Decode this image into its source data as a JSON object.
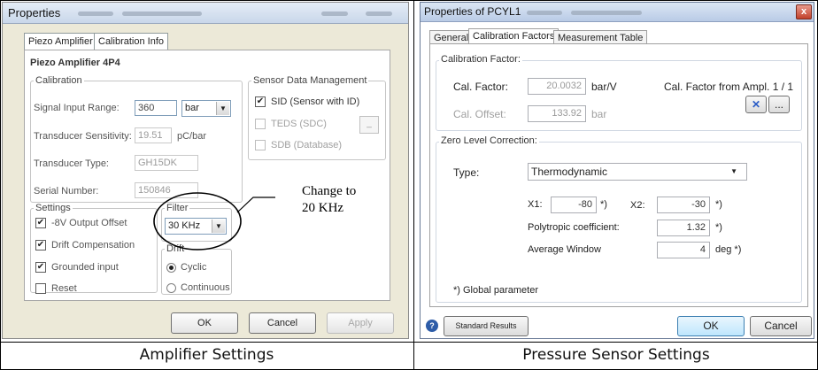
{
  "amplifier": {
    "window_title": "Properties",
    "tabs": [
      "Piezo Amplifier",
      "Calibration Info"
    ],
    "heading": "Piezo Amplifier 4P4",
    "calibration": {
      "group": "Calibration",
      "signal_input_range_label": "Signal Input Range:",
      "signal_input_range_value": "360",
      "signal_unit": "bar",
      "transducer_sensitivity_label": "Transducer Sensitivity:",
      "transducer_sensitivity_value": "19.51",
      "sensitivity_unit": "pC/bar",
      "transducer_type_label": "Transducer Type:",
      "transducer_type_value": "GH15DK",
      "serial_number_label": "Serial Number:",
      "serial_number_value": "150846"
    },
    "sensor_data": {
      "group": "Sensor Data Management",
      "sid": "SID (Sensor with ID)",
      "teds": "TEDS (SDC)",
      "sdb": "SDB (Database)"
    },
    "settings": {
      "group": "Settings",
      "output_offset": "-8V Output Offset",
      "drift_compensation": "Drift Compensation",
      "grounded_input": "Grounded input",
      "reset": "Reset"
    },
    "filter": {
      "group": "Filter",
      "value": "30 KHz"
    },
    "drift": {
      "group": "Drift",
      "cyclic": "Cyclic",
      "continuous": "Continuous"
    },
    "buttons": {
      "ok": "OK",
      "cancel": "Cancel",
      "apply": "Apply"
    },
    "annotation": "Change to\n20 KHz"
  },
  "sensor": {
    "window_title": "Properties of PCYL1",
    "close": "x",
    "tabs": [
      "General",
      "Calibration Factors",
      "Measurement Table"
    ],
    "calibration_factor": {
      "group": "Calibration Factor:",
      "cal_factor_label": "Cal. Factor:",
      "cal_factor_value": "20.0032",
      "cal_factor_unit": "bar/V",
      "cal_offset_label": "Cal. Offset:",
      "cal_offset_value": "133.92",
      "cal_offset_unit": "bar",
      "from_ampl_label": "Cal. Factor from Ampl. 1 / 1",
      "x_button": "✕",
      "more_button": "..."
    },
    "zero_level": {
      "group": "Zero Level Correction:",
      "type_label": "Type:",
      "type_value": "Thermodynamic",
      "x1_label": "X1:",
      "x1_value": "-80",
      "x1_suffix": "*)",
      "x2_label": "X2:",
      "x2_value": "-30",
      "x2_suffix": "*)",
      "polytropic_label": "Polytropic coefficient:",
      "polytropic_value": "1.32",
      "polytropic_suffix": "*)",
      "avg_window_label": "Average Window",
      "avg_window_value": "4",
      "avg_window_suffix": "deg *)",
      "global_param": "*) Global parameter"
    },
    "buttons": {
      "standard_results": "Standard Results",
      "ok": "OK",
      "cancel": "Cancel"
    }
  },
  "captions": {
    "left": "Amplifier Settings",
    "right": "Pressure Sensor Settings"
  }
}
